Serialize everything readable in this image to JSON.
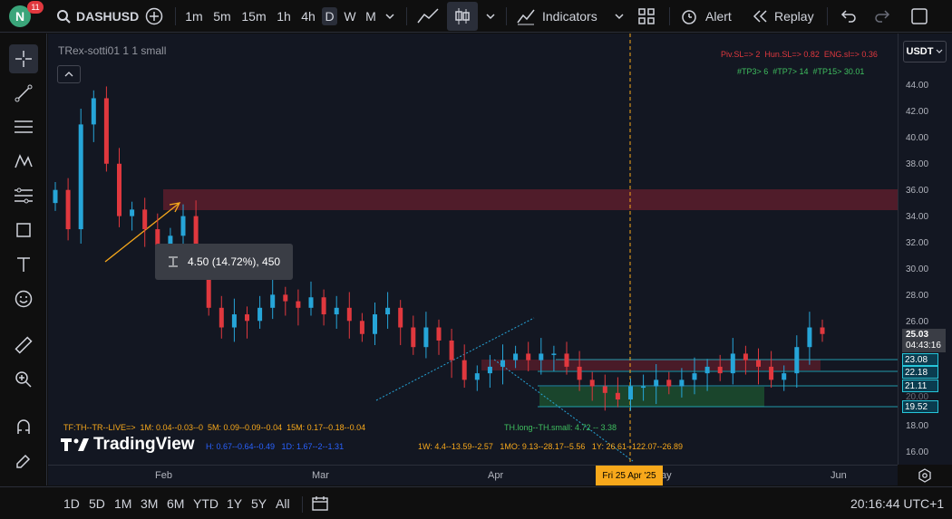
{
  "app": {
    "logo_letter": "N",
    "notifications": "11",
    "symbol": "DASHUSD"
  },
  "timeframes": [
    "1m",
    "5m",
    "15m",
    "1h",
    "4h",
    "D",
    "W",
    "M"
  ],
  "toolbar": {
    "indicators_label": "Indicators",
    "alert_label": "Alert",
    "replay_label": "Replay"
  },
  "chart": {
    "indicator_title": "TRex-sotti01 1 1 small",
    "stats_red": "Piv.SL=> 2  Hun.SL=> 0.82  ENG.sl=> 0.36",
    "stats_green": "#TP3> 6  #TP7> 14  #TP15> 30.01",
    "measure_label": "4.50 (14.72%), 450",
    "tf_line": "TF:TH--TR--LIVE=>  1M: 0.04--0.03--0  5M: 0.09--0.09--0.04  15M: 0.17--0.18--0.04",
    "h_line": "H: 0.67--0.64--0.49   1D: 1.67--2--1.31",
    "w_line": "1W: 4.4--13.59--2.57   1MO: 9.13--28.17--5.56   1Y: 26.61--122.07--26.89",
    "th_line": "TH.long--TH.small: 4.72 -- 3.38",
    "watermark": "TradingView",
    "currency": "USDT"
  },
  "price_axis": {
    "ticks": [
      "44.00",
      "42.00",
      "40.00",
      "38.00",
      "36.00",
      "34.00",
      "32.00",
      "30.00",
      "28.00",
      "26.00",
      "18.00",
      "16.00"
    ],
    "current_price": "25.03",
    "countdown": "04:43:16",
    "levels": [
      "23.08",
      "22.18",
      "21.11",
      "20.00",
      "19.52"
    ]
  },
  "time_axis": {
    "labels": [
      "Feb",
      "Mar",
      "Apr",
      "ay",
      "Jun"
    ],
    "crosshair_date": "Fri 25 Apr '25"
  },
  "bottom": {
    "ranges": [
      "1D",
      "5D",
      "1M",
      "3M",
      "6M",
      "YTD",
      "1Y",
      "5Y",
      "All"
    ],
    "clock": "20:16:44 UTC+1"
  },
  "colors": {
    "up": "#26a5d8",
    "down": "#e0383e",
    "zone_red": "#5c1d2b",
    "zone_green": "#1c4a2e",
    "accent": "#f7a81b"
  }
}
